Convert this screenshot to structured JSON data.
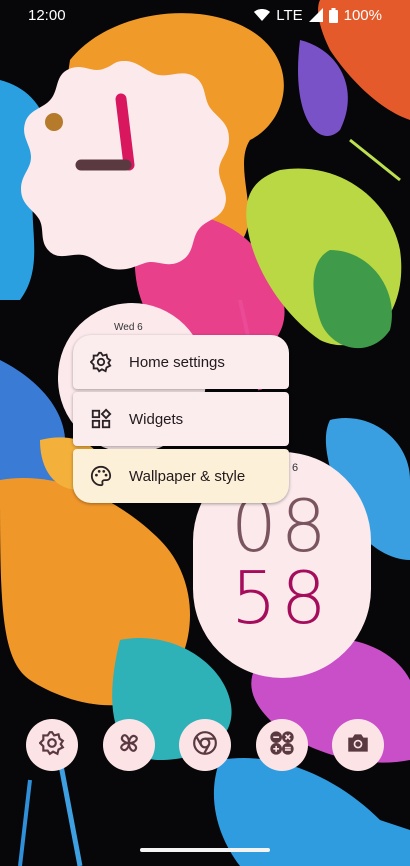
{
  "status_bar": {
    "time": "12:00",
    "network": "LTE",
    "battery": "100%",
    "icons": [
      "wifi-icon",
      "signal-icon",
      "battery-icon"
    ]
  },
  "analog_clock": {
    "hour_hand_color": "#d8175f",
    "minute_hand_color": "#5a3a40",
    "dot_color": "#b57a2a",
    "face_color": "#fbe9ec"
  },
  "date_card": {
    "date": "Wed 6"
  },
  "digital_clock": {
    "date": "6",
    "hour": "08",
    "minute": "58"
  },
  "context_menu": {
    "items": [
      {
        "label": "Home settings",
        "icon": "gear-icon"
      },
      {
        "label": "Widgets",
        "icon": "widgets-icon"
      },
      {
        "label": "Wallpaper & style",
        "icon": "palette-icon"
      }
    ]
  },
  "dock": {
    "apps": [
      {
        "icon": "settings-icon"
      },
      {
        "icon": "pinwheel-icon"
      },
      {
        "icon": "chrome-icon"
      },
      {
        "icon": "calculator-icon"
      },
      {
        "icon": "camera-icon"
      }
    ]
  },
  "colors": {
    "surface": "#fbecee",
    "highlight": "#fdf0d8",
    "accent": "#a50d5c"
  }
}
